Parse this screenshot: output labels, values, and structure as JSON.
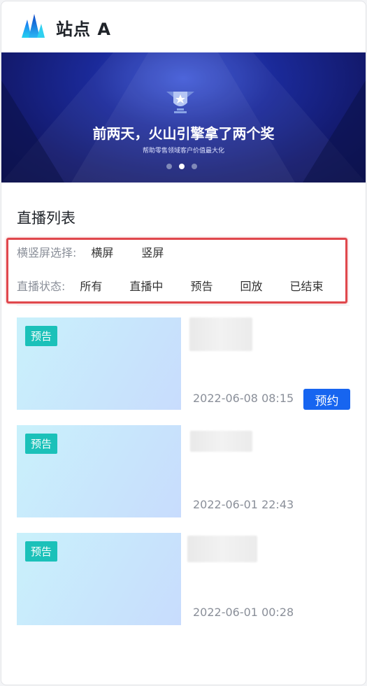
{
  "header": {
    "site_title": "站点 A",
    "logo_icon": "brand-peaks-icon"
  },
  "banner": {
    "title": "前两天，火山引擎拿了两个奖",
    "subtitle": "帮助零售领域客户价值最大化",
    "slide_count": 3,
    "active_slide": 2,
    "icon": "trophy-icon"
  },
  "live_list": {
    "title": "直播列表",
    "orientation": {
      "label": "横竖屏选择:",
      "options": [
        "横屏",
        "竖屏"
      ]
    },
    "status": {
      "label": "直播状态:",
      "options": [
        "所有",
        "直播中",
        "预告",
        "回放",
        "已结束"
      ]
    },
    "items": [
      {
        "badge": "预告",
        "date": "2022-06-08 08:15",
        "action": "预约"
      },
      {
        "badge": "预告",
        "date": "2022-06-01 22:43"
      },
      {
        "badge": "预告",
        "date": "2022-06-01 00:28"
      }
    ]
  },
  "colors": {
    "accent": "#1765f0",
    "badge": "#1bc1b9",
    "highlight_border": "#e0484d"
  }
}
